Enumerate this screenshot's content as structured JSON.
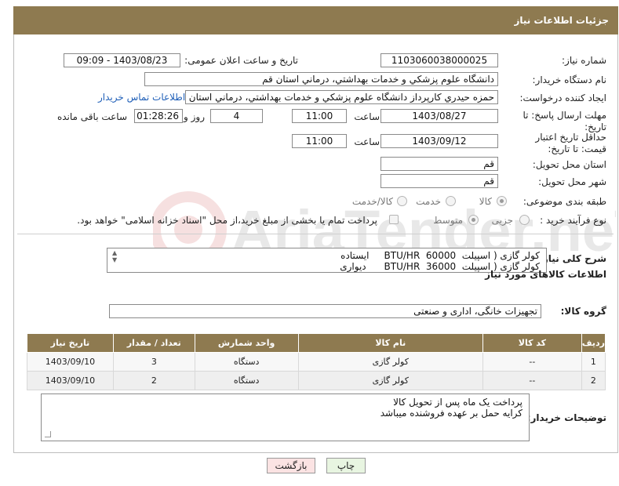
{
  "header": {
    "title": "جزئیات اطلاعات نیاز"
  },
  "fields": {
    "need_number_label": "شماره نیاز:",
    "need_number": "1103060038000025",
    "announce_label": "تاریخ و ساعت اعلان عمومی:",
    "announce_value": "1403/08/23 - 09:09",
    "buyer_org_label": "نام دستگاه خریدار:",
    "buyer_org": "دانشگاه علوم پزشكي و خدمات بهداشتي، درماني استان قم",
    "creator_label": "ایجاد کننده درخواست:",
    "creator": "حمزه حيدري كارپرداز دانشگاه علوم پزشكي و خدمات بهداشتي، درماني استان قم",
    "contact_link": "اطلاعات تماس خریدار",
    "reply_deadline_label": "مهلت ارسال پاسخ: تا تاریخ:",
    "reply_date": "1403/08/27",
    "time_label": "ساعت",
    "reply_time": "11:00",
    "days_value": "4",
    "days_label": "روز و",
    "remaining_time": "01:28:26",
    "remaining_label": "ساعت باقی مانده",
    "price_validity_label": "حداقل تاریخ اعتبار قیمت: تا تاریخ:",
    "price_date": "1403/09/12",
    "price_time": "11:00",
    "province_label": "استان محل تحویل:",
    "province": "قم",
    "city_label": "شهر محل تحویل:",
    "city": "قم",
    "category_label": "طبقه بندی موضوعی:",
    "category_options": [
      "کالا",
      "خدمت",
      "کالا/خدمت"
    ],
    "process_label": "نوع فرآیند خرید :",
    "process_options": [
      "جزیی",
      "متوسط"
    ],
    "payment_note": "پرداخت تمام یا بخشی از مبلغ خرید،از محل \"اسناد خزانه اسلامی\" خواهد بود."
  },
  "summary": {
    "label": "شرح کلی نیاز:",
    "lines": [
      "کولر گازی ( اسپیلت  60000  BTU/HR     ایستاده",
      "کولر گازی ( اسپیلت  36000  BTU/HR      دیواری"
    ]
  },
  "goods_section": {
    "title": "اطلاعات کالاهای مورد نیاز",
    "group_label": "گروه کالا:",
    "group_value": "تجهیزات خانگی، اداری و صنعتی"
  },
  "table": {
    "headers": [
      "ردیف",
      "کد کالا",
      "نام کالا",
      "واحد شمارش",
      "تعداد / مقدار",
      "تاریخ نیاز"
    ],
    "rows": [
      [
        "1",
        "--",
        "کولر گازی",
        "دستگاه",
        "3",
        "1403/09/10"
      ],
      [
        "2",
        "--",
        "کولر گازی",
        "دستگاه",
        "2",
        "1403/09/10"
      ]
    ]
  },
  "notes": {
    "label": "توضیحات خریدار:",
    "lines": [
      "پرداخت یک ماه پس از تحویل کالا",
      "کرایه حمل بر عهده فروشنده میباشد"
    ]
  },
  "buttons": {
    "print": "چاپ",
    "back": "بازگشت"
  },
  "watermark": {
    "text": "AriaTender.neT"
  },
  "colors": {
    "header_bg": "#8e7a50",
    "print_bg": "#e8f5e1",
    "back_bg": "#fbe3e3",
    "link": "#1f5fb8"
  }
}
